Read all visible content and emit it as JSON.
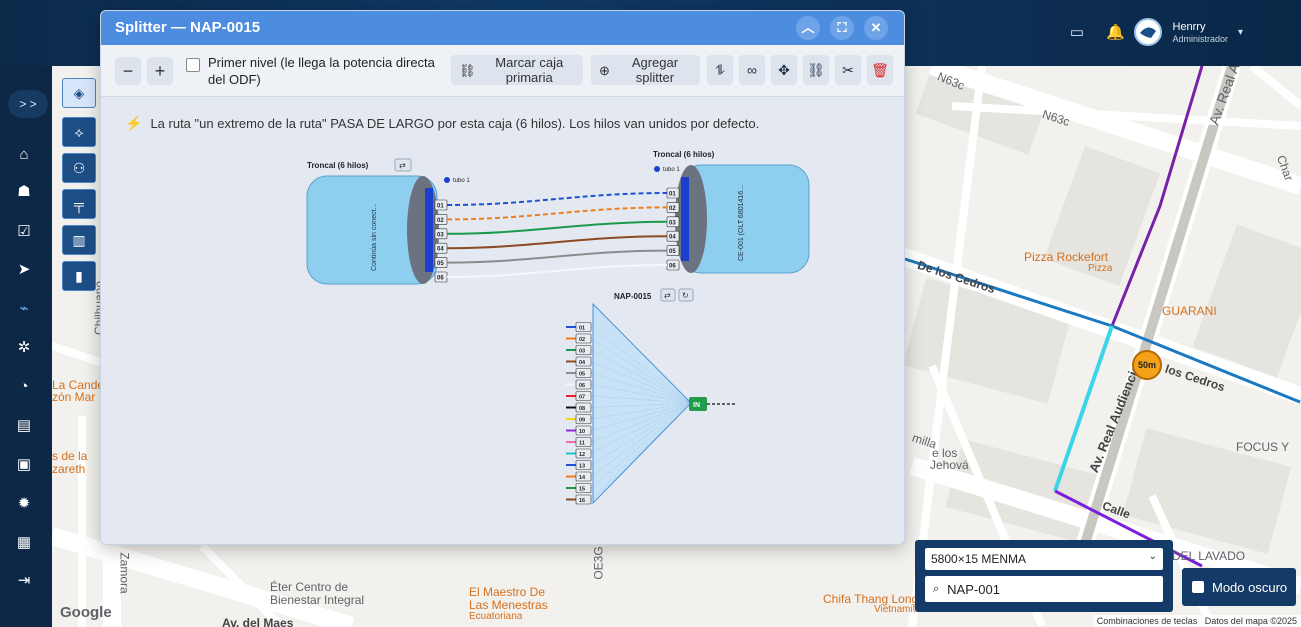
{
  "header": {
    "user_name": "Henrry",
    "user_role": "Administrador"
  },
  "sidebar": {
    "toggle": "> >",
    "items": [
      {
        "icon": "home-icon",
        "glyph": "⌂"
      },
      {
        "icon": "users-icon",
        "glyph": "☗"
      },
      {
        "icon": "tasks-icon",
        "glyph": "☑"
      },
      {
        "icon": "telegram-icon",
        "glyph": "➤"
      },
      {
        "icon": "network-icon",
        "glyph": "⌁"
      },
      {
        "icon": "settings-group-icon",
        "glyph": "✲"
      },
      {
        "icon": "dashboard-icon",
        "glyph": "◔"
      },
      {
        "icon": "archive-icon",
        "glyph": "▤"
      },
      {
        "icon": "wallet-icon",
        "glyph": "▣"
      },
      {
        "icon": "gear-icon",
        "glyph": "✹"
      },
      {
        "icon": "toolbox-icon",
        "glyph": "▦"
      },
      {
        "icon": "logout-icon",
        "glyph": "⇥"
      }
    ]
  },
  "dialog": {
    "title": "Splitter — NAP-0015",
    "toolbar": {
      "minus": "−",
      "plus": "+",
      "checkbox_label": "Primer nivel (le llega la potencia directa del ODF)",
      "mark_primary": "Marcar caja primaria",
      "add_splitter": "Agregar splitter"
    },
    "notice": "La ruta \"un extremo de la ruta\" PASA DE LARGO por esta caja (6 hilos). Los hilos van unidos por defecto.",
    "left_cable": {
      "title": "Troncal (6 hilos)",
      "body_text": "Continúa sin conect...",
      "tube_label": "tubo 1",
      "fibers": [
        "01",
        "02",
        "03",
        "04",
        "05",
        "06"
      ]
    },
    "right_cable": {
      "title": "Troncal (6 hilos)",
      "body_text": "CE-001 (OLT 6801416...",
      "tube_label": "tubo 1",
      "fibers": [
        "01",
        "02",
        "03",
        "04",
        "05",
        "06"
      ]
    },
    "splitter": {
      "title": "NAP-0015",
      "input_label": "IN",
      "ports": [
        "01",
        "02",
        "03",
        "04",
        "05",
        "06",
        "07",
        "08",
        "09",
        "10",
        "11",
        "12",
        "13",
        "14",
        "15",
        "16"
      ]
    },
    "fiber_colors": [
      "#1f4fd8",
      "#f07c1a",
      "#1a9a4a",
      "#8a4a22",
      "#8c8c8c",
      "#ffffff",
      "#e8202a",
      "#111111",
      "#f2d41a",
      "#8a2ad8",
      "#f06ab0",
      "#18c7c7"
    ]
  },
  "map": {
    "labels": [
      "N63c",
      "N63c",
      "Av. Real A",
      "Pizza Rockefort",
      "Pizza",
      "GUARANI",
      "De los Cedros",
      "los Cedros",
      "Av. Real Audiencia",
      "FOCUS Y",
      "Char",
      "Éter Centro de",
      "Bienestar Integral",
      "El Maestro De",
      "Las Menestras",
      "Ecuatoriana",
      "Chifa Thang Long",
      "Vietnamita",
      "DEL LAVADO",
      "Zamora",
      "OE3G",
      "Calle",
      "milla",
      "illa",
      "e los",
      "Jehová",
      "Chilhuano",
      "La Cande",
      "zón Mar",
      "s de la",
      "zareth",
      "Av. del Maes"
    ],
    "distance_badge": "50m",
    "google": "Google",
    "attrib_1": "Combinaciones de teclas",
    "attrib_2": "Datos del mapa ©2025"
  },
  "controls": {
    "dropdown_value": "5800×15 MENMA",
    "search_value": "NAP-001",
    "dark_mode_label": "Modo oscuro"
  }
}
